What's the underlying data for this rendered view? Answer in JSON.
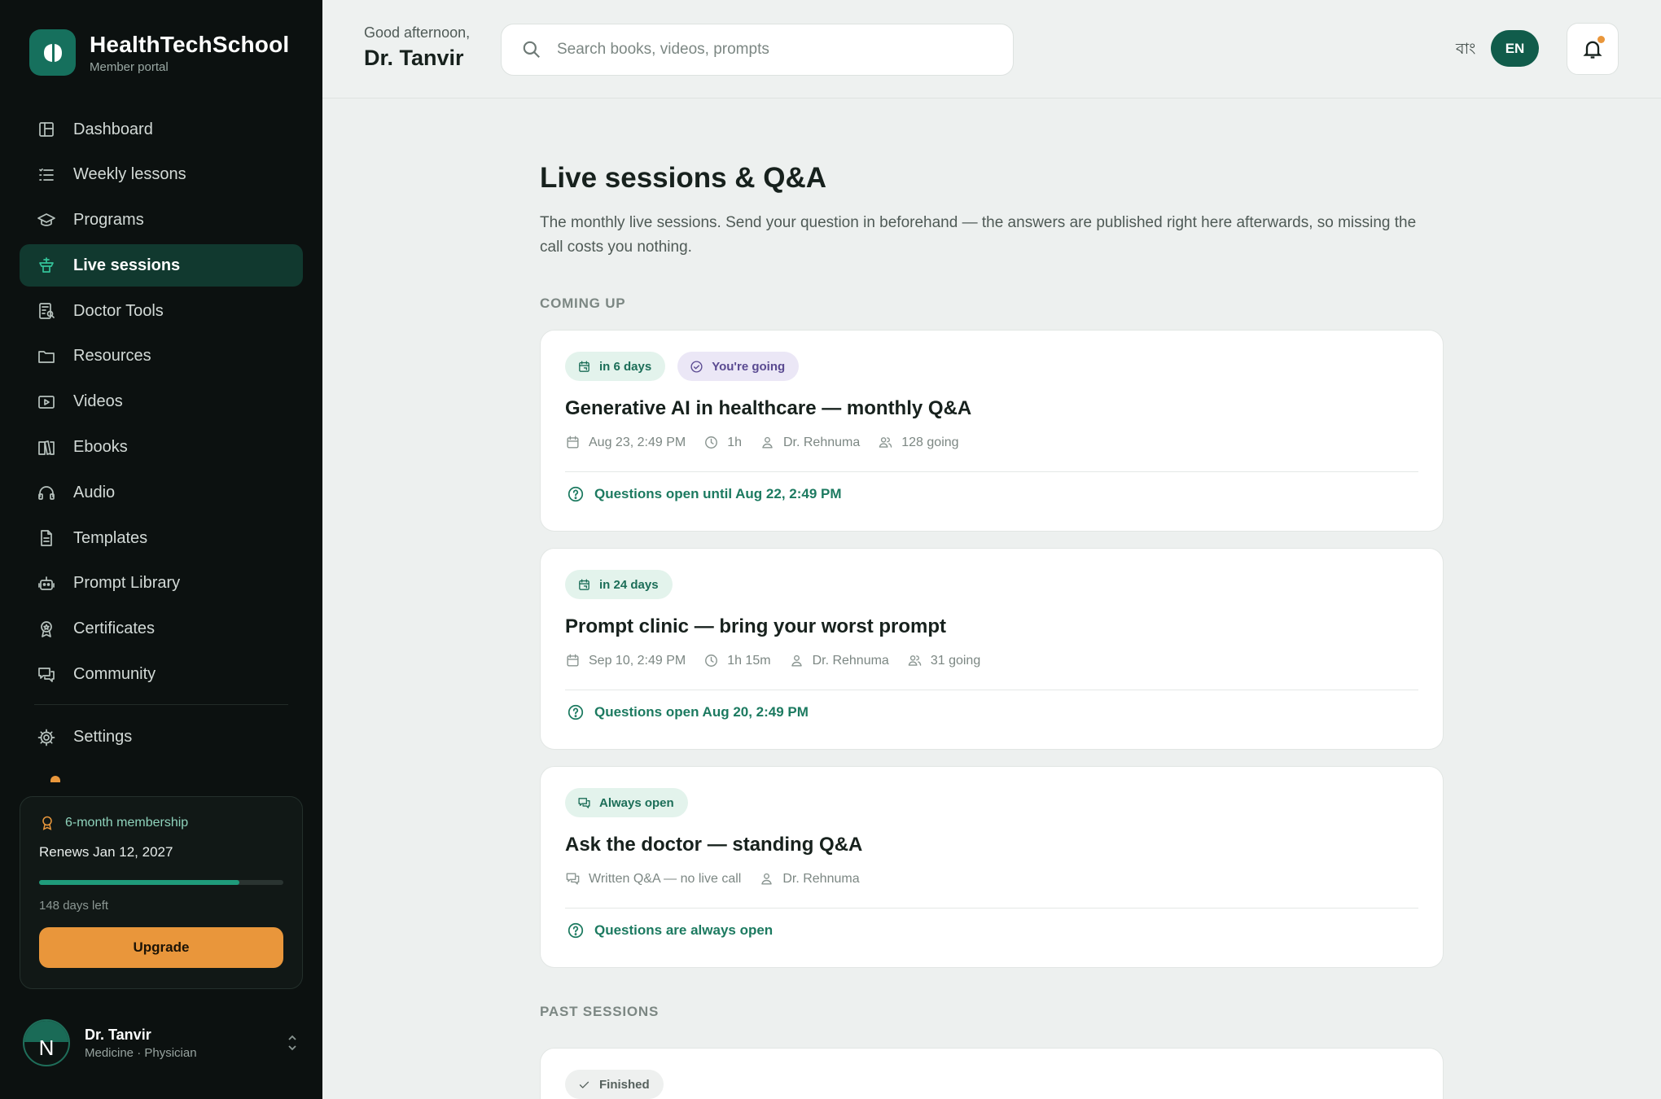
{
  "brand": {
    "name": "HealthTechSchool",
    "subtitle": "Member portal"
  },
  "sidebar": {
    "items": [
      {
        "label": "Dashboard",
        "icon": "layout-icon",
        "active": false
      },
      {
        "label": "Weekly lessons",
        "icon": "list-icon",
        "active": false
      },
      {
        "label": "Programs",
        "icon": "graduation-cap-icon",
        "active": false
      },
      {
        "label": "Live sessions",
        "icon": "podium-icon",
        "active": true
      },
      {
        "label": "Doctor Tools",
        "icon": "tools-icon",
        "active": false
      },
      {
        "label": "Resources",
        "icon": "folder-icon",
        "active": false
      },
      {
        "label": "Videos",
        "icon": "video-icon",
        "active": false
      },
      {
        "label": "Ebooks",
        "icon": "book-icon",
        "active": false
      },
      {
        "label": "Audio",
        "icon": "headphones-icon",
        "active": false
      },
      {
        "label": "Templates",
        "icon": "file-icon",
        "active": false
      },
      {
        "label": "Prompt Library",
        "icon": "robot-icon",
        "active": false
      },
      {
        "label": "Certificates",
        "icon": "award-icon",
        "active": false
      },
      {
        "label": "Community",
        "icon": "chat-icon",
        "active": false
      }
    ],
    "settings": {
      "label": "Settings",
      "icon": "gear-icon"
    },
    "membership": {
      "title": "6-month membership",
      "renews": "Renews Jan 12, 2027",
      "progress_percent": 82,
      "days_left": "148 days left",
      "upgrade_label": "Upgrade"
    },
    "user": {
      "name": "Dr. Tanvir",
      "role": "Medicine · Physician",
      "avatar_letter": "N"
    }
  },
  "topbar": {
    "greeting": "Good afternoon,",
    "name": "Dr. Tanvir",
    "search_placeholder": "Search books, videos, prompts",
    "lang_bn": "বাং",
    "lang_en": "EN"
  },
  "main": {
    "title": "Live sessions & Q&A",
    "description": "The monthly live sessions. Send your question in beforehand — the answers are published right here afterwards, so missing the call costs you nothing.",
    "coming_up_label": "COMING UP",
    "past_label": "PAST SESSIONS",
    "sessions": [
      {
        "badges": [
          {
            "text": "in 6 days",
            "style": "green",
            "icon": "calendar-icon"
          },
          {
            "text": "You're going",
            "style": "purple",
            "icon": "check-circle-icon"
          }
        ],
        "title": "Generative AI in healthcare — monthly Q&A",
        "date": "Aug 23, 2:49 PM",
        "duration": "1h",
        "host": "Dr. Rehnuma",
        "going": "128 going",
        "questions": "Questions open until Aug 22, 2:49 PM"
      },
      {
        "badges": [
          {
            "text": "in 24 days",
            "style": "green",
            "icon": "calendar-icon"
          }
        ],
        "title": "Prompt clinic — bring your worst prompt",
        "date": "Sep 10, 2:49 PM",
        "duration": "1h 15m",
        "host": "Dr. Rehnuma",
        "going": "31 going",
        "questions": "Questions open Aug 20, 2:49 PM"
      },
      {
        "badges": [
          {
            "text": "Always open",
            "style": "green",
            "icon": "chat-icon"
          }
        ],
        "title": "Ask the doctor — standing Q&A",
        "format": "Written Q&A — no live call",
        "host": "Dr. Rehnuma",
        "questions": "Questions are always open"
      }
    ],
    "past_sessions": [
      {
        "badges": [
          {
            "text": "Finished",
            "style": "gray",
            "icon": "check-icon"
          }
        ]
      }
    ]
  },
  "colors": {
    "accent": "#16705d",
    "active_nav": "#11392f",
    "upgrade": "#e9963b",
    "link": "#1c7a60"
  }
}
